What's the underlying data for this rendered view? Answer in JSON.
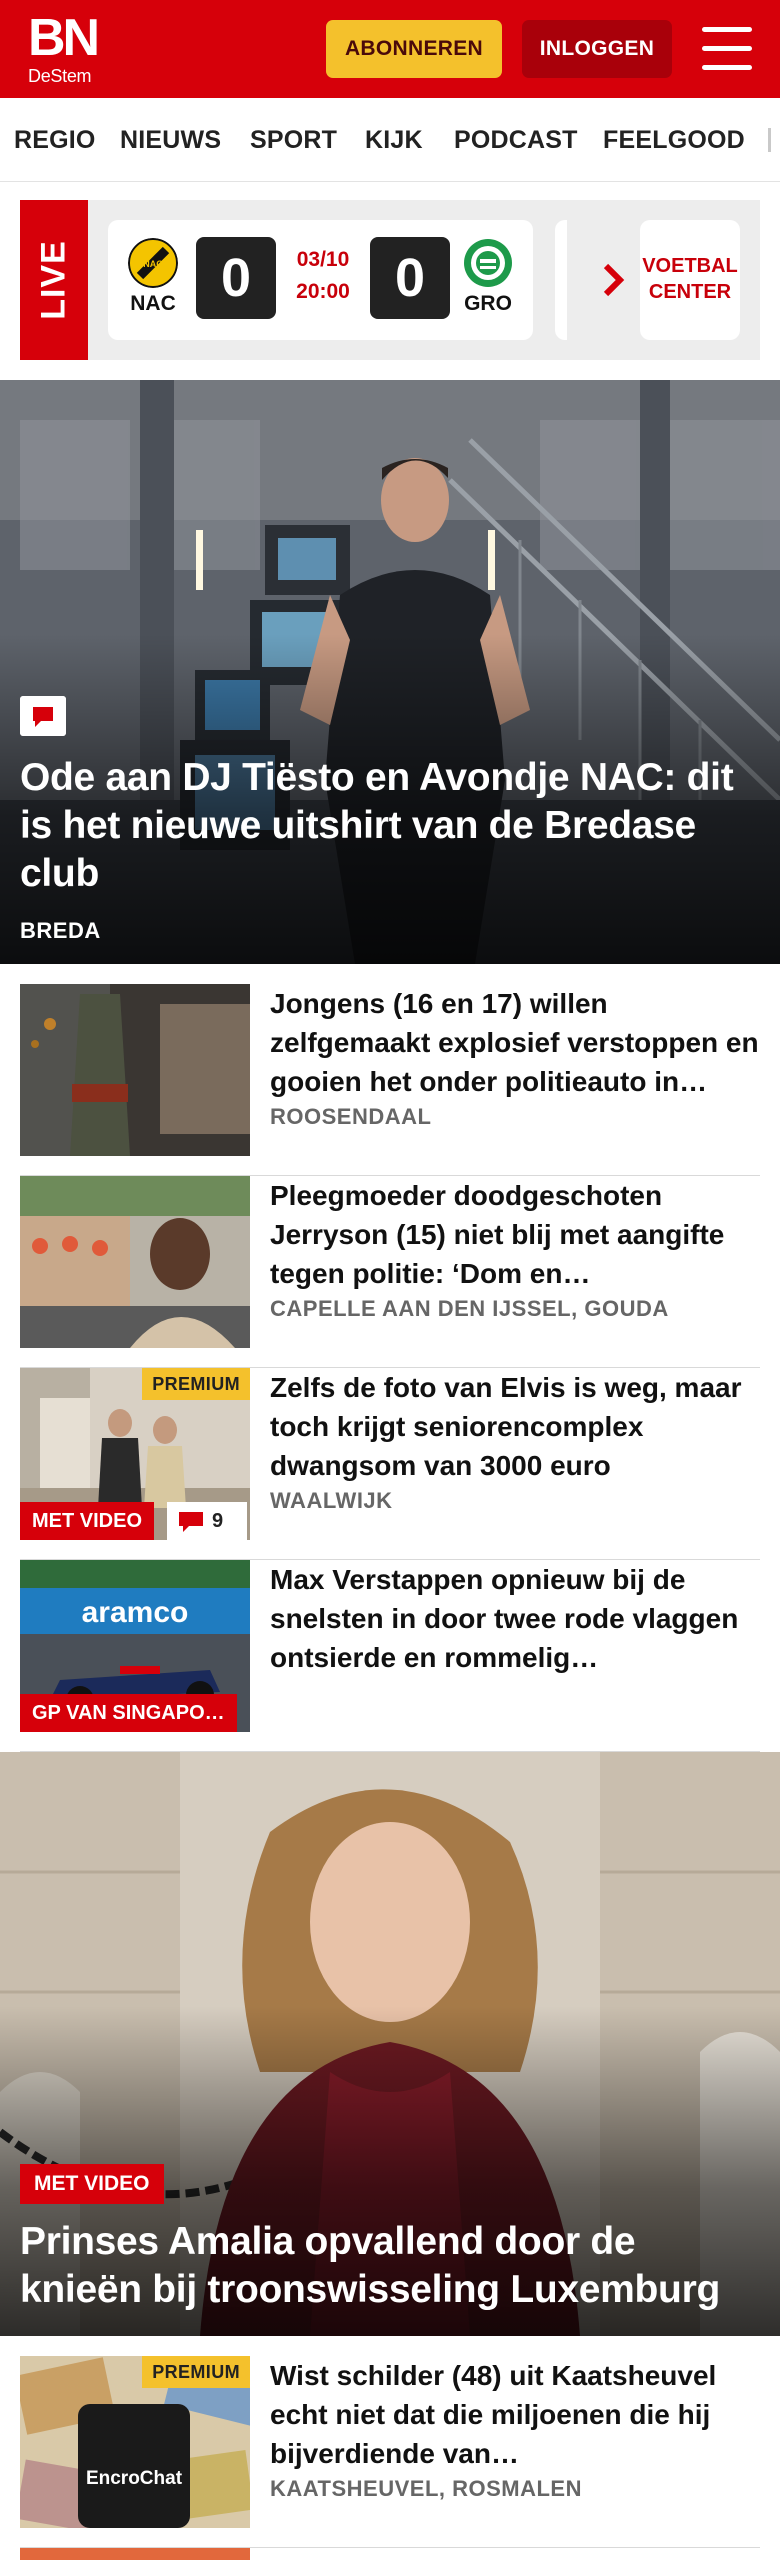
{
  "header": {
    "logo_top": "BN",
    "logo_bottom": "DeStem",
    "subscribe_label": "ABONNEREN",
    "login_label": "INLOGGEN",
    "menu_icon": "hamburger-menu-icon",
    "brand_color": "#d6000a"
  },
  "nav": {
    "items": [
      "REGIO",
      "NIEUWS",
      "SPORT",
      "KIJK",
      "PODCAST",
      "FEELGOOD"
    ]
  },
  "live": {
    "label": "LIVE",
    "home_team": "NAC",
    "home_score": "0",
    "date": "03/10",
    "time": "20:00",
    "away_score": "0",
    "away_team": "GRO",
    "voetbal_center": "VOETBAL CENTER",
    "chevron_icon": "chevron-right-icon"
  },
  "hero1": {
    "title": "Ode aan DJ Tiësto en Avondje NAC: dit is het nieuwe uitshirt van de Bredase club",
    "tag": "BREDA",
    "comment_icon": "comment-icon"
  },
  "articles": [
    {
      "title": "Jongens (16 en 17) willen zelfgemaakt explosief verstoppen en gooien het onder politieauto in…",
      "location": "ROOSENDAAL"
    },
    {
      "title": "Pleegmoeder doodgeschoten Jerryson (15) niet blij met aangifte tegen politie: ‘Dom en…",
      "location": "CAPELLE AAN DEN IJSSEL, GOUDA"
    },
    {
      "title": "Zelfs de foto van Elvis is weg, maar toch krijgt seniorencomplex dwangsom van 3000 euro",
      "location": "WAALWIJK",
      "premium": "PREMIUM",
      "video": "MET VIDEO",
      "comments": "9"
    },
    {
      "title": "Max Verstappen opnieuw bij de snelsten in door twee rode vlaggen ontsierde en rommelig…",
      "location": "",
      "video": "GP VAN SINGAPO…"
    }
  ],
  "hero2": {
    "title": "Prinses Amalia opvallend door de knieën bij troonswisseling Luxemburg",
    "video": "MET VIDEO"
  },
  "articles2": [
    {
      "title": "Wist schilder (48) uit Kaatsheuvel echt niet dat die miljoenen die hij bijverdiende van…",
      "location": "KAATSHEUVEL, ROSMALEN",
      "premium": "PREMIUM"
    }
  ]
}
